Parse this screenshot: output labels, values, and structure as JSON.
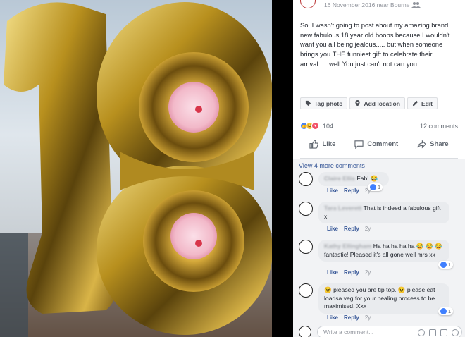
{
  "post": {
    "date": "16 November 2016 near Bourne",
    "text": "So. I wasn't going to post about my amazing brand new fabulous 18 year old boobs because I wouldn't want you all being jealous..... but when someone brings you THE funniest gift to celebrate their arrival..... well You just can't not can you ....",
    "actions": {
      "tag_photo": "Tag photo",
      "add_location": "Add location",
      "edit": "Edit"
    },
    "reaction_count": "104",
    "comments_count": "12 comments",
    "buttons": {
      "like": "Like",
      "comment": "Comment",
      "share": "Share"
    }
  },
  "comments": {
    "view_more": "View 4 more comments",
    "items": [
      {
        "name": "Claire Ellis",
        "text": "Fab! 😂",
        "reactions": "1",
        "like": "Like",
        "reply": "Reply",
        "time": "2y"
      },
      {
        "name": "Tara Leverett",
        "text": "That is indeed a fabulous gift x",
        "like": "Like",
        "reply": "Reply",
        "time": "2y"
      },
      {
        "name": "Kathy Ellingham",
        "text": "Ha ha ha ha ha 😂 😂 😂 fantastic! Pleased it's all gone well mrs xx",
        "reactions": "1",
        "like": "Like",
        "reply": "Reply",
        "time": "2y"
      },
      {
        "name": "",
        "text": "😉 pleased you are tip top. 😉 please eat loadsa veg for your healing process to be maximised. Xxx",
        "reactions": "1",
        "like": "Like",
        "reply": "Reply",
        "time": "2y"
      }
    ],
    "write_placeholder": "Write a comment..."
  },
  "colors": {
    "link": "#385898",
    "like_blue": "#4080ff",
    "balloon_gold": "#c9a227"
  }
}
